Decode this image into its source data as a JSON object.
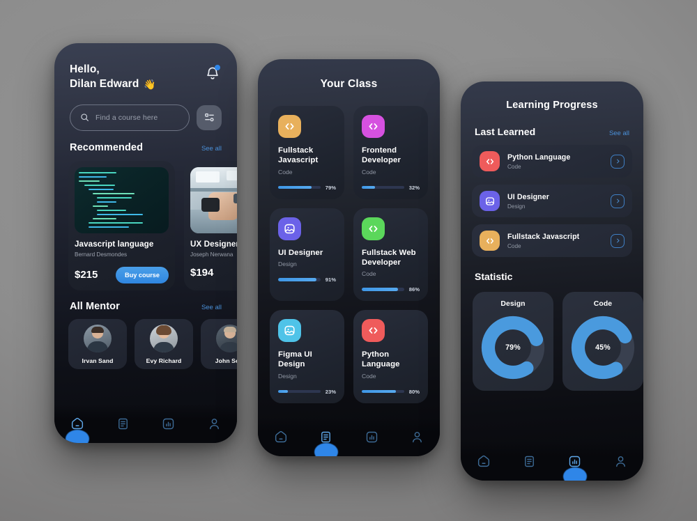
{
  "colors": {
    "accent": "#2f86e8",
    "seeall": "#4a90d9",
    "bg": "#8d8d8d"
  },
  "phone1": {
    "greeting_line1": "Hello,",
    "greeting_line2": "Dilan Edward",
    "wave_emoji": "👋",
    "search": {
      "placeholder": "Find a course here",
      "value": ""
    },
    "recommended": {
      "title": "Recommended",
      "see_all": "See all",
      "courses": [
        {
          "name": "Javascript language",
          "author": "Bernard Desmondes",
          "price": "$215",
          "cta": "Buy course"
        },
        {
          "name": "UX Designer",
          "author": "Joseph Nerwana",
          "price": "$194",
          "cta": ""
        }
      ]
    },
    "mentors": {
      "title": "All Mentor",
      "see_all": "See all",
      "people": [
        {
          "name": "Irvan Sand"
        },
        {
          "name": "Evy Richard"
        },
        {
          "name": "John Sept"
        }
      ]
    },
    "nav": {
      "active_index": 0,
      "items": [
        "home-icon",
        "document-icon",
        "chart-icon",
        "profile-icon"
      ]
    }
  },
  "phone2": {
    "title": "Your Class",
    "classes": [
      {
        "name": "Fullstack Javascript",
        "category": "Code",
        "progress": 79,
        "progress_label": "79%",
        "icon": "code-icon",
        "color": "#e8b05c"
      },
      {
        "name": "Frontend Developer",
        "category": "Code",
        "progress": 32,
        "progress_label": "32%",
        "icon": "code-icon",
        "color": "#d651e0"
      },
      {
        "name": "UI Designer",
        "category": "Design",
        "progress": 91,
        "progress_label": "91%",
        "icon": "image-icon",
        "color": "#6b62e8"
      },
      {
        "name": "Fullstack Web Developer",
        "category": "Code",
        "progress": 86,
        "progress_label": "86%",
        "icon": "code-icon",
        "color": "#5bd75b"
      },
      {
        "name": "Figma UI Design",
        "category": "Design",
        "progress": 23,
        "progress_label": "23%",
        "icon": "image-icon",
        "color": "#4fc3e8"
      },
      {
        "name": "Python Language",
        "category": "Code",
        "progress": 80,
        "progress_label": "80%",
        "icon": "code-icon",
        "color": "#ef5b5b"
      }
    ],
    "nav": {
      "active_index": 1,
      "items": [
        "home-icon",
        "document-icon",
        "chart-icon",
        "profile-icon"
      ]
    }
  },
  "phone3": {
    "title": "Learning Progress",
    "last_learned": {
      "title": "Last Learned",
      "see_all": "See all",
      "items": [
        {
          "name": "Python Language",
          "category": "Code",
          "icon": "code-icon",
          "color": "#ef5b5b"
        },
        {
          "name": "UI Designer",
          "category": "Design",
          "icon": "image-icon",
          "color": "#6b62e8"
        },
        {
          "name": "Fullstack Javascript",
          "category": "Code",
          "icon": "code-icon",
          "color": "#e8b05c"
        }
      ]
    },
    "statistic": {
      "title": "Statistic",
      "charts": [
        {
          "label": "Design",
          "value": 79,
          "value_label": "79%"
        },
        {
          "label": "Code",
          "value": 45,
          "value_label": "45%"
        }
      ]
    },
    "nav": {
      "active_index": 2,
      "items": [
        "home-icon",
        "document-icon",
        "chart-icon",
        "profile-icon"
      ]
    }
  },
  "chart_data": {
    "type": "pie",
    "title": "Statistic",
    "categories": [
      "Design",
      "Code"
    ],
    "values": [
      79,
      45
    ],
    "unit": "%",
    "ylim": [
      0,
      100
    ],
    "legend": "none",
    "note": "Two donut gauges; blue arc proportion = percent complete"
  }
}
